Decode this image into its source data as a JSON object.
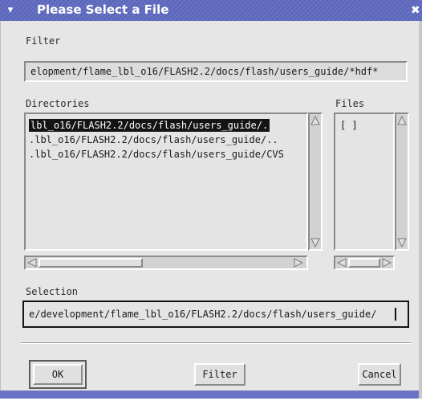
{
  "window": {
    "title": "Please Select a File",
    "menu_glyph": "▾",
    "close_glyph": "✖"
  },
  "filter": {
    "label": "Filter",
    "value": "elopment/flame_lbl_o16/FLASH2.2/docs/flash/users_guide/*hdf*"
  },
  "directories": {
    "label": "Directories",
    "items": [
      "lbl_o16/FLASH2.2/docs/flash/users_guide/.",
      ".lbl_o16/FLASH2.2/docs/flash/users_guide/..",
      ".lbl_o16/FLASH2.2/docs/flash/users_guide/CVS"
    ],
    "selected_index": 0
  },
  "files": {
    "label": "Files",
    "items": [
      "[    ]"
    ]
  },
  "selection": {
    "label": "Selection",
    "value": "e/development/flame_lbl_o16/FLASH2.2/docs/flash/users_guide/"
  },
  "buttons": {
    "ok": "OK",
    "filter": "Filter",
    "cancel": "Cancel"
  },
  "colors": {
    "title_bar": "#5a64b8",
    "dialog_bg": "#e6e6e6",
    "selection_bg": "#141414"
  }
}
